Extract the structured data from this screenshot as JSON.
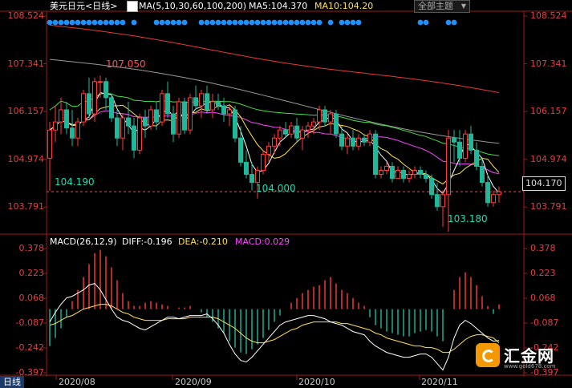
{
  "header": {
    "symbol": "美元日元",
    "period": "<日线>",
    "ma_label": "MA(5,10,30,60,100,200)",
    "ma5": "MA5:104.370",
    "ma10": "MA10:104.20",
    "theme_button": "全部主题"
  },
  "macd_header": {
    "label": "MACD(26,12,9)",
    "diff": "DIFF:-0.196",
    "dea": "DEA:-0.210",
    "macd": "MACD:0.029"
  },
  "price_axis": [
    "108.524",
    "107.341",
    "106.157",
    "104.974",
    "103.791"
  ],
  "macd_axis": [
    "0.378",
    "0.223",
    "0.068",
    "-0.087",
    "-0.242",
    "-0.397"
  ],
  "date_labels": [
    "2020/08",
    "2020/09",
    "2020/10",
    "2020/11"
  ],
  "annotations": {
    "high": "107.050",
    "low1": "104.190",
    "low2": "104.000",
    "low3": "103.180"
  },
  "current_price": "104.170",
  "period_tab": "日线",
  "logo": {
    "name": "汇金网",
    "site": "www.gold678.com"
  },
  "colors": {
    "up": "#ff3c3c",
    "down": "#1fb89a",
    "ma5": "#ffffff",
    "ma10": "#ffe24d",
    "ma30": "#ff44ff",
    "ma60": "#44dd44",
    "ma100": "#999999",
    "ma200": "#e53935",
    "axis": "#e04040",
    "grid": "#9b1b1b"
  },
  "chart_data": [
    {
      "type": "candlestick",
      "title": "美元日元 <日线>",
      "ylim": [
        103.2,
        108.524
      ],
      "ohlc": [
        [
          105.0,
          105.9,
          104.19,
          105.7
        ],
        [
          105.7,
          106.3,
          105.4,
          105.9
        ],
        [
          105.9,
          106.5,
          105.6,
          106.2
        ],
        [
          106.2,
          106.4,
          105.6,
          105.75
        ],
        [
          105.75,
          106.2,
          105.3,
          105.5
        ],
        [
          105.5,
          106.0,
          105.3,
          105.9
        ],
        [
          105.9,
          106.7,
          105.8,
          106.6
        ],
        [
          106.6,
          107.0,
          106.0,
          106.1
        ],
        [
          106.1,
          107.0,
          105.9,
          106.9
        ],
        [
          106.9,
          107.05,
          106.5,
          106.9
        ],
        [
          106.9,
          107.0,
          106.2,
          106.5
        ],
        [
          106.5,
          106.6,
          105.9,
          106.0
        ],
        [
          106.0,
          106.2,
          105.3,
          105.5
        ],
        [
          105.5,
          106.1,
          105.2,
          106.0
        ],
        [
          106.0,
          106.4,
          105.6,
          105.8
        ],
        [
          105.8,
          106.0,
          105.0,
          105.2
        ],
        [
          105.2,
          106.1,
          105.1,
          106.0
        ],
        [
          106.0,
          106.2,
          105.5,
          105.8
        ],
        [
          105.8,
          106.3,
          105.7,
          106.2
        ],
        [
          106.2,
          106.4,
          105.7,
          105.9
        ],
        [
          105.9,
          106.7,
          105.8,
          106.6
        ],
        [
          106.6,
          106.9,
          106.0,
          106.1
        ],
        [
          106.1,
          106.3,
          105.4,
          105.6
        ],
        [
          105.6,
          106.5,
          105.5,
          106.4
        ],
        [
          106.4,
          106.5,
          105.6,
          105.7
        ],
        [
          105.7,
          106.6,
          105.6,
          106.5
        ],
        [
          106.5,
          106.8,
          106.2,
          106.3
        ],
        [
          106.3,
          106.7,
          106.0,
          106.6
        ],
        [
          106.6,
          106.8,
          106.1,
          106.2
        ],
        [
          106.2,
          106.6,
          106.0,
          106.4
        ],
        [
          106.4,
          106.6,
          106.2,
          106.3
        ],
        [
          106.3,
          106.5,
          105.9,
          106.1
        ],
        [
          106.1,
          106.3,
          105.8,
          106.2
        ],
        [
          106.2,
          106.3,
          105.4,
          105.5
        ],
        [
          105.5,
          105.8,
          104.8,
          104.9
        ],
        [
          104.9,
          105.2,
          104.5,
          104.6
        ],
        [
          104.6,
          104.9,
          104.2,
          104.4
        ],
        [
          104.4,
          104.8,
          104.0,
          104.7
        ],
        [
          104.7,
          105.2,
          104.6,
          105.1
        ],
        [
          105.1,
          105.4,
          104.9,
          105.3
        ],
        [
          105.3,
          105.6,
          105.1,
          105.5
        ],
        [
          105.5,
          105.8,
          105.3,
          105.7
        ],
        [
          105.7,
          105.9,
          105.5,
          105.6
        ],
        [
          105.6,
          105.9,
          105.5,
          105.8
        ],
        [
          105.8,
          106.0,
          105.4,
          105.5
        ],
        [
          105.5,
          105.8,
          105.2,
          105.7
        ],
        [
          105.7,
          105.9,
          105.5,
          105.8
        ],
        [
          105.8,
          106.0,
          105.6,
          105.9
        ],
        [
          105.9,
          106.3,
          105.7,
          106.2
        ],
        [
          106.2,
          106.3,
          105.8,
          105.9
        ],
        [
          105.9,
          106.2,
          105.6,
          106.1
        ],
        [
          106.1,
          106.2,
          105.5,
          105.6
        ],
        [
          105.6,
          105.8,
          105.2,
          105.3
        ],
        [
          105.3,
          105.6,
          105.1,
          105.5
        ],
        [
          105.5,
          105.7,
          105.2,
          105.3
        ],
        [
          105.3,
          105.6,
          105.2,
          105.5
        ],
        [
          105.5,
          105.6,
          105.3,
          105.4
        ],
        [
          105.4,
          105.7,
          105.3,
          105.6
        ],
        [
          105.6,
          105.7,
          104.5,
          104.6
        ],
        [
          104.6,
          104.8,
          104.5,
          104.7
        ],
        [
          104.7,
          104.9,
          104.6,
          104.8
        ],
        [
          104.8,
          104.9,
          104.4,
          104.5
        ],
        [
          104.5,
          104.8,
          104.5,
          104.7
        ],
        [
          104.7,
          104.8,
          104.4,
          104.5
        ],
        [
          104.5,
          104.7,
          104.4,
          104.6
        ],
        [
          104.6,
          104.8,
          104.5,
          104.7
        ],
        [
          104.7,
          104.8,
          104.5,
          104.6
        ],
        [
          104.6,
          104.7,
          104.4,
          104.5
        ],
        [
          104.5,
          104.6,
          104.0,
          104.1
        ],
        [
          104.1,
          104.4,
          103.7,
          103.8
        ],
        [
          103.8,
          104.2,
          103.3,
          104.1
        ],
        [
          104.1,
          105.7,
          103.18,
          105.5
        ],
        [
          105.5,
          105.7,
          104.9,
          105.4
        ],
        [
          105.4,
          105.7,
          104.8,
          105.0
        ],
        [
          105.0,
          105.7,
          104.9,
          105.6
        ],
        [
          105.6,
          105.8,
          105.1,
          105.2
        ],
        [
          105.2,
          105.4,
          104.7,
          104.8
        ],
        [
          104.8,
          105.0,
          104.3,
          104.4
        ],
        [
          104.4,
          104.6,
          103.8,
          103.9
        ],
        [
          103.9,
          104.2,
          103.8,
          104.1
        ],
        [
          104.1,
          104.3,
          103.9,
          104.17
        ]
      ],
      "annotations": [
        "107.050",
        "104.190",
        "104.000",
        "103.180"
      ],
      "current": 104.17
    },
    {
      "type": "bar",
      "title": "MACD(26,12,9)",
      "ylim": [
        -0.397,
        0.378
      ],
      "macd": [
        -0.23,
        -0.18,
        -0.12,
        -0.05,
        0.05,
        0.12,
        0.2,
        0.28,
        0.35,
        0.37,
        0.33,
        0.26,
        0.18,
        0.1,
        0.05,
        0.02,
        0.02,
        0.04,
        0.05,
        0.04,
        0.03,
        0.02,
        0.0,
        0.01,
        0.01,
        0.02,
        0.0,
        -0.02,
        -0.05,
        -0.08,
        -0.12,
        -0.15,
        -0.2,
        -0.24,
        -0.27,
        -0.28,
        -0.25,
        -0.22,
        -0.18,
        -0.13,
        -0.08,
        -0.04,
        0.0,
        0.04,
        0.07,
        0.1,
        0.12,
        0.14,
        0.15,
        0.18,
        0.2,
        0.16,
        0.12,
        0.1,
        0.07,
        0.04,
        0.02,
        -0.05,
        -0.1,
        -0.12,
        -0.14,
        -0.15,
        -0.16,
        -0.17,
        -0.17,
        -0.15,
        -0.14,
        -0.13,
        -0.14,
        -0.17,
        -0.2,
        0.0,
        0.12,
        0.2,
        0.23,
        0.2,
        0.15,
        0.08,
        0.02,
        -0.03,
        0.03
      ],
      "diff": [
        -0.08,
        -0.02,
        0.03,
        0.07,
        0.08,
        0.1,
        0.12,
        0.15,
        0.16,
        0.12,
        0.06,
        0.0,
        -0.05,
        -0.07,
        -0.08,
        -0.1,
        -0.12,
        -0.13,
        -0.11,
        -0.09,
        -0.07,
        -0.05,
        -0.05,
        -0.06,
        -0.05,
        -0.04,
        -0.04,
        -0.04,
        -0.03,
        -0.06,
        -0.1,
        -0.15,
        -0.22,
        -0.28,
        -0.32,
        -0.33,
        -0.3,
        -0.26,
        -0.22,
        -0.18,
        -0.14,
        -0.1,
        -0.08,
        -0.07,
        -0.06,
        -0.05,
        -0.04,
        -0.04,
        -0.05,
        -0.06,
        -0.08,
        -0.09,
        -0.1,
        -0.12,
        -0.14,
        -0.15,
        -0.16,
        -0.2,
        -0.23,
        -0.25,
        -0.27,
        -0.28,
        -0.29,
        -0.3,
        -0.3,
        -0.29,
        -0.28,
        -0.28,
        -0.3,
        -0.34,
        -0.38,
        -0.3,
        -0.18,
        -0.1,
        -0.07,
        -0.09,
        -0.12,
        -0.15,
        -0.18,
        -0.2,
        -0.196
      ],
      "dea": [
        -0.1,
        -0.09,
        -0.07,
        -0.05,
        -0.04,
        -0.02,
        0.0,
        0.01,
        0.02,
        0.03,
        0.03,
        0.02,
        0.0,
        -0.02,
        -0.03,
        -0.05,
        -0.06,
        -0.07,
        -0.07,
        -0.07,
        -0.07,
        -0.06,
        -0.06,
        -0.06,
        -0.06,
        -0.05,
        -0.05,
        -0.05,
        -0.05,
        -0.05,
        -0.06,
        -0.08,
        -0.1,
        -0.12,
        -0.15,
        -0.18,
        -0.2,
        -0.21,
        -0.21,
        -0.2,
        -0.19,
        -0.17,
        -0.15,
        -0.13,
        -0.12,
        -0.1,
        -0.09,
        -0.08,
        -0.08,
        -0.08,
        -0.08,
        -0.08,
        -0.09,
        -0.09,
        -0.1,
        -0.11,
        -0.12,
        -0.13,
        -0.15,
        -0.16,
        -0.18,
        -0.19,
        -0.2,
        -0.21,
        -0.22,
        -0.23,
        -0.23,
        -0.24,
        -0.24,
        -0.25,
        -0.27,
        -0.27,
        -0.25,
        -0.22,
        -0.19,
        -0.17,
        -0.16,
        -0.16,
        -0.17,
        -0.18,
        -0.21
      ]
    }
  ]
}
